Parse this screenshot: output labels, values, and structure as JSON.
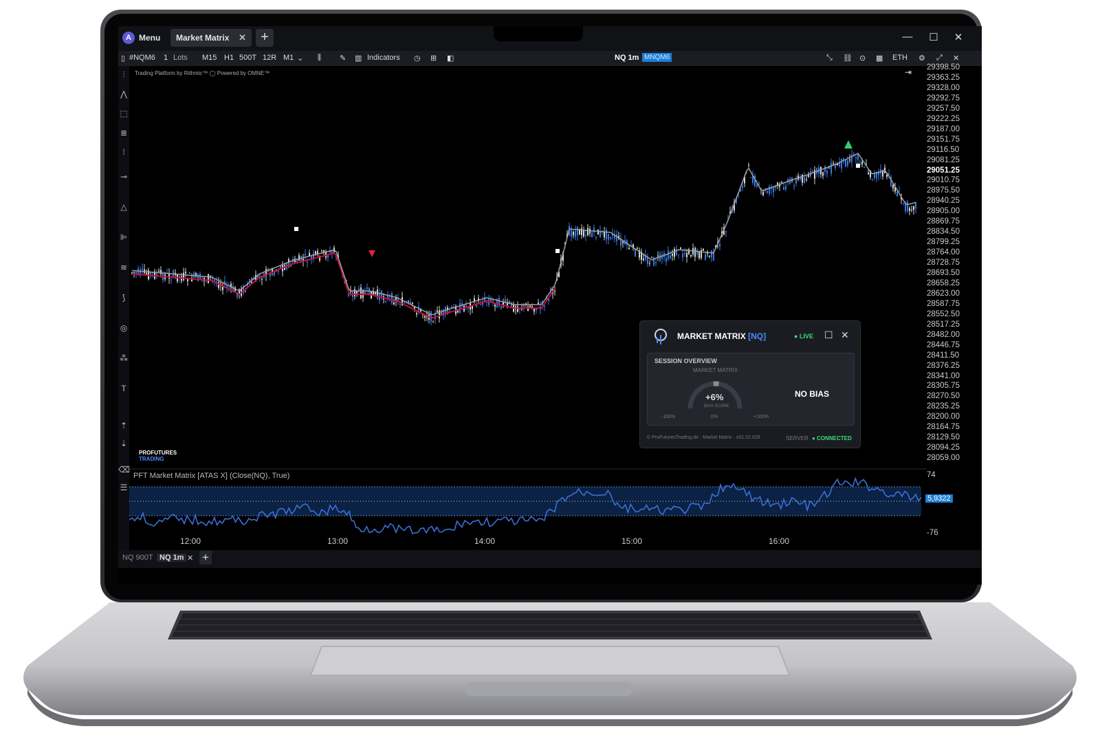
{
  "window": {
    "menu_label": "Menu",
    "tab_label": "Market Matrix",
    "new_tab": "+",
    "controls": {
      "minimize": "—",
      "maximize": "☐",
      "close": "✕"
    }
  },
  "toolbar": {
    "symbol": "#NQM6",
    "qty": "1",
    "qty_unit": "Lots",
    "timeframes": [
      "M15",
      "H1",
      "500T",
      "12R",
      "M1"
    ],
    "indicators_label": "Indicators",
    "chart_name": "NQ 1m",
    "contract_tag": "MNQM6",
    "session": "ETH"
  },
  "chart": {
    "credit": "Trading Platform by Rithmic™  ◯ Powered by OMNE™",
    "price_labels": [
      "29398.50",
      "29363.25",
      "29328.00",
      "29292.75",
      "29257.50",
      "29222.25",
      "29187.00",
      "29151.75",
      "29116.50",
      "29081.25",
      "29051.25",
      "29010.75",
      "28975.50",
      "28940.25",
      "28905.00",
      "28869.75",
      "28834.50",
      "28799.25",
      "28764.00",
      "28728.75",
      "28693.50",
      "28658.25",
      "28623.00",
      "28587.75",
      "28552.50",
      "28517.25",
      "28482.00",
      "28446.75",
      "28411.50",
      "28376.25",
      "28341.00",
      "28305.75",
      "28270.50",
      "28235.25",
      "28200.00",
      "28164.75",
      "28129.50",
      "28094.25",
      "28059.00"
    ],
    "current_price": "29051.25",
    "logo_top": "PROFUTURES",
    "logo_bottom": "TRADING",
    "time_labels": [
      "12:00",
      "13:00",
      "14:00",
      "15:00",
      "16:00"
    ],
    "colors": {
      "up": "#3a78e0",
      "down": "#d9d9d9",
      "ema": "#c0103a",
      "ema2": "#a0a0a0"
    }
  },
  "indicator": {
    "label": "PFT Market Matrix [ATAS X] (Close(NQ), True)",
    "scale_top": "74",
    "scale_bottom": "-76",
    "current_value": "5,9322"
  },
  "bottom_tabs": {
    "tab1": "NQ 900T",
    "tab2": "NQ 1m",
    "new_tab": "+"
  },
  "widget": {
    "title": "MARKET MATRIX",
    "symbol": "[NQ]",
    "live": "● LIVE",
    "section_title": "SESSION OVERVIEW",
    "gauge_sub": "MARKET MATRIX",
    "bias_percent": "+6%",
    "bias_score": "BIAS SCORE",
    "tick_left": "-100%",
    "tick_mid": "0%",
    "tick_right": "+100%",
    "bias_label": "NO BIAS",
    "footer": "© ProFuturesTrading.de · Market Matrix · v01.02.029",
    "server_label": "SERVER",
    "server_status": "● CONNECTED",
    "gauge_level": 0.06
  }
}
